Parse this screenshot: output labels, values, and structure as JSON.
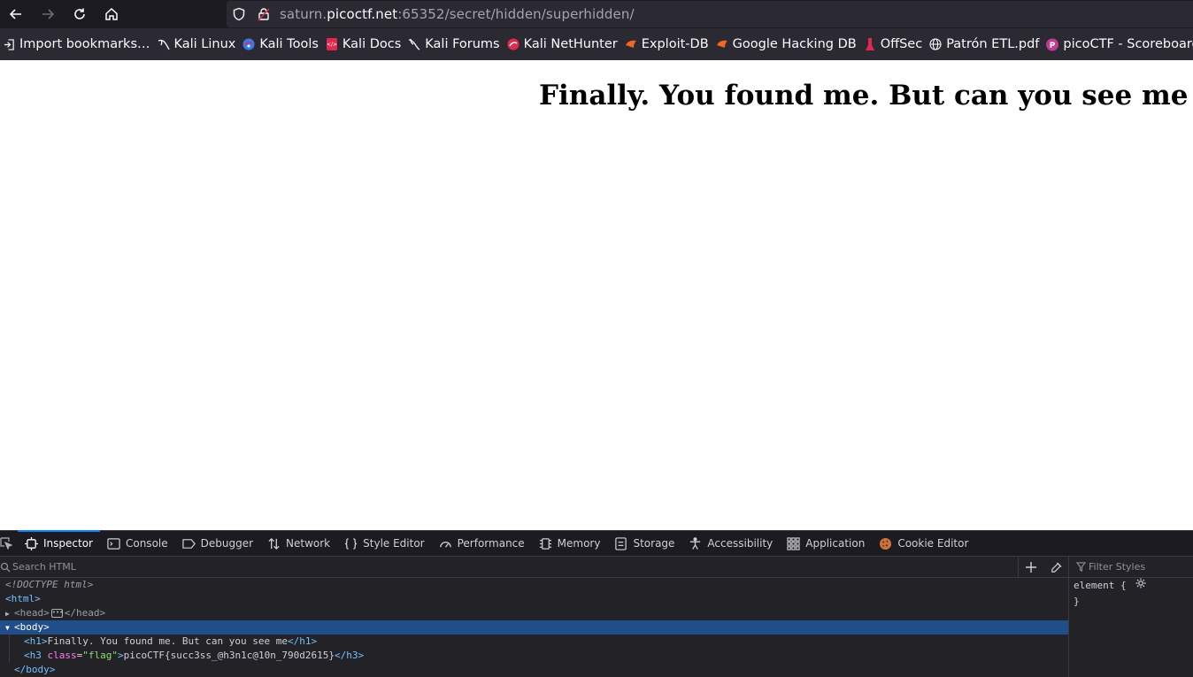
{
  "navbar": {
    "url_prefix": "saturn.",
    "url_host": "picoctf.net",
    "url_suffix": ":65352/secret/hidden/superhidden/"
  },
  "bookmarks": [
    {
      "label": "Import bookmarks…",
      "icon": "import-icon"
    },
    {
      "label": "Kali Linux",
      "icon": "kali-dragon-icon"
    },
    {
      "label": "Kali Tools",
      "icon": "kali-tools-icon"
    },
    {
      "label": "Kali Docs",
      "icon": "kali-docs-icon"
    },
    {
      "label": "Kali Forums",
      "icon": "kali-forums-icon"
    },
    {
      "label": "Kali NetHunter",
      "icon": "nethunter-icon"
    },
    {
      "label": "Exploit-DB",
      "icon": "exploitdb-icon"
    },
    {
      "label": "Google Hacking DB",
      "icon": "ghdb-icon"
    },
    {
      "label": "OffSec",
      "icon": "offsec-icon"
    },
    {
      "label": "Patrón ETL.pdf",
      "icon": "globe-icon"
    },
    {
      "label": "picoCTF - Scoreboards",
      "icon": "picoctf-icon"
    }
  ],
  "page": {
    "heading": "Finally. You found me. But can you see me"
  },
  "devtools": {
    "tabs": [
      {
        "label": "Inspector",
        "icon": "inspector-icon",
        "active": true
      },
      {
        "label": "Console",
        "icon": "console-icon"
      },
      {
        "label": "Debugger",
        "icon": "debugger-icon"
      },
      {
        "label": "Network",
        "icon": "network-icon"
      },
      {
        "label": "Style Editor",
        "icon": "style-editor-icon"
      },
      {
        "label": "Performance",
        "icon": "performance-icon"
      },
      {
        "label": "Memory",
        "icon": "memory-icon"
      },
      {
        "label": "Storage",
        "icon": "storage-icon"
      },
      {
        "label": "Accessibility",
        "icon": "accessibility-icon"
      },
      {
        "label": "Application",
        "icon": "application-icon"
      },
      {
        "label": "Cookie Editor",
        "icon": "cookie-icon"
      }
    ],
    "search_placeholder": "Search HTML",
    "filter_placeholder": "Filter Styles",
    "markup": {
      "doctype": "<!DOCTYPE html>",
      "html_open": "<html>",
      "head_open": "<head>",
      "head_close": "</head>",
      "body_open": "<body>",
      "h1_open": "<h1>",
      "h1_text": "Finally. You found me. But can you see me",
      "h1_close": "</h1>",
      "h3_open_start": "<h3 ",
      "h3_attr_name": "class",
      "h3_attr_eq": "=",
      "h3_attr_val": "\"flag\"",
      "h3_open_end": ">",
      "h3_text": "picoCTF{succ3ss_@h3n1c@10n_790d2615}",
      "h3_close": "</h3>",
      "body_close": "</body>"
    },
    "rule": {
      "selector": "element {",
      "close": "}"
    }
  }
}
